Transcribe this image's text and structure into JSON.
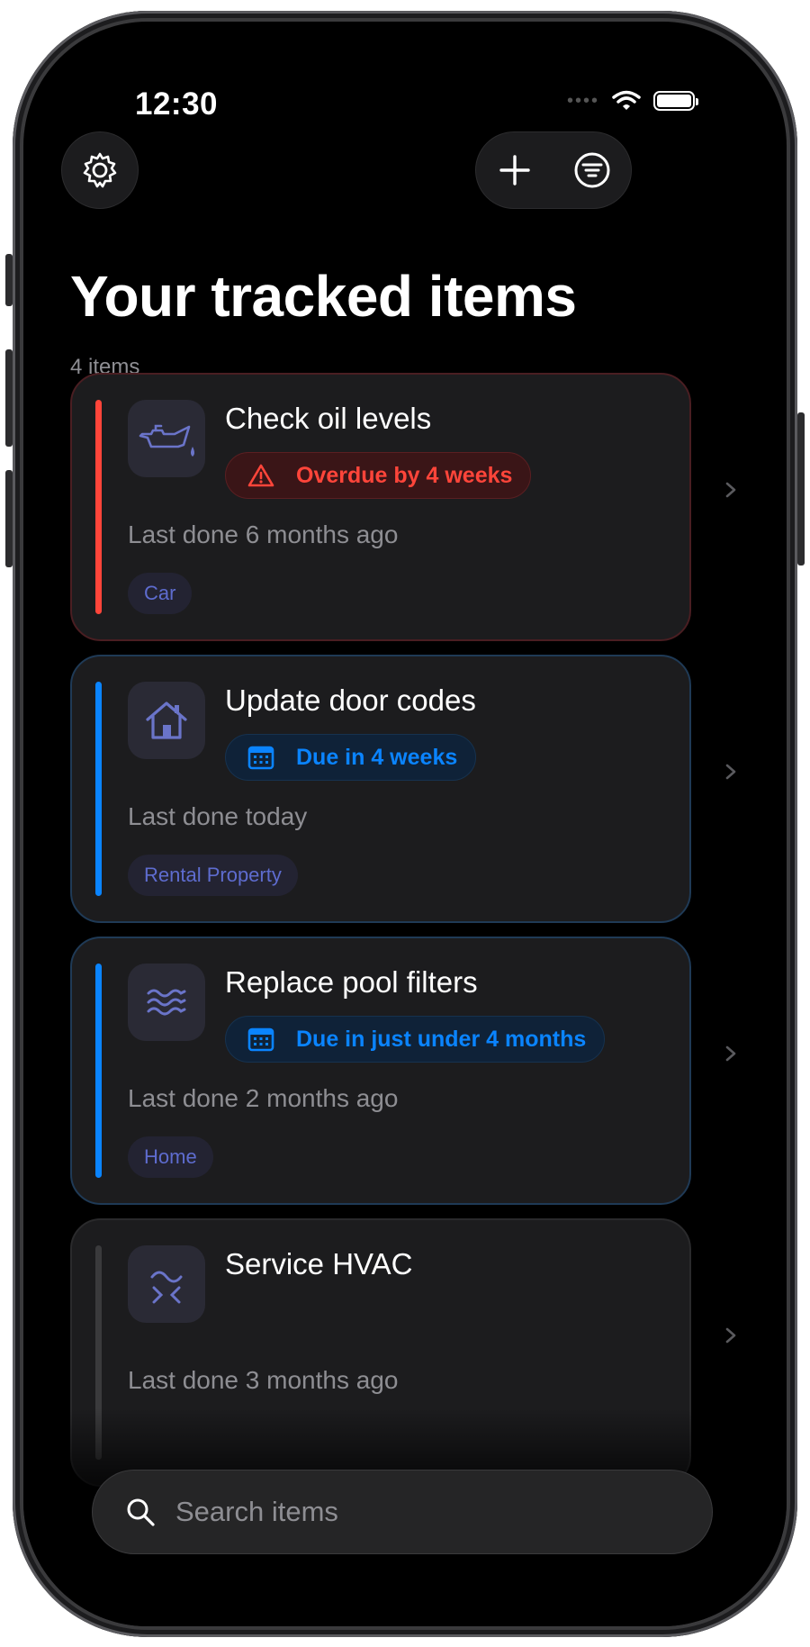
{
  "status_bar": {
    "time": "12:30"
  },
  "toolbar": {
    "settings_icon": "gear-icon",
    "add_icon": "plus-icon",
    "filter_icon": "filter-icon"
  },
  "header": {
    "title": "Your tracked items",
    "count": "4 items"
  },
  "items": [
    {
      "title": "Check oil levels",
      "status": "Overdue by 4 weeks",
      "status_type": "overdue",
      "status_icon": "warning-icon",
      "last_done": "Last done 6 months ago",
      "tag": "Car",
      "icon": "oil-can-icon",
      "accent": "#ff453a"
    },
    {
      "title": "Update door codes",
      "status": "Due in 4 weeks",
      "status_type": "upcoming",
      "status_icon": "calendar-icon",
      "last_done": "Last done today",
      "tag": "Rental Property",
      "icon": "house-icon",
      "accent": "#0a84ff"
    },
    {
      "title": "Replace pool filters",
      "status": "Due in just under 4 months",
      "status_type": "upcoming",
      "status_icon": "calendar-icon",
      "last_done": "Last done 2 months ago",
      "tag": "Home",
      "icon": "water-waves-icon",
      "accent": "#0a84ff"
    },
    {
      "title": "Service HVAC",
      "last_done": "Last done 3 months ago",
      "icon": "hvac-icon"
    }
  ],
  "search": {
    "placeholder": "Search items"
  }
}
